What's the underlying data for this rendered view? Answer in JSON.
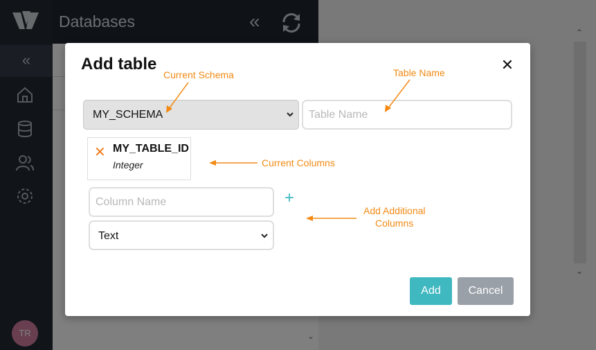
{
  "sidebar": {
    "collapse_glyph": "«",
    "user_initials": "TR",
    "icons": [
      "logo-icon",
      "home-icon",
      "database-icon",
      "users-icon",
      "gear-icon"
    ]
  },
  "databases_panel": {
    "title": "Databases",
    "collapse_glyph": "«",
    "scroll_down_glyph": "⌄"
  },
  "main": {
    "scroll_up_glyph": "⌃",
    "scroll_down_glyph": "⌄"
  },
  "modal": {
    "title": "Add table",
    "close_glyph": "✕",
    "schema_select": {
      "value": "MY_SCHEMA"
    },
    "table_name_input": {
      "placeholder": "Table Name",
      "value": ""
    },
    "columns": [
      {
        "name": "MY_TABLE_ID",
        "type": "Integer",
        "remove_glyph": "✕"
      }
    ],
    "new_column": {
      "name_placeholder": "Column Name",
      "type_value": "Text",
      "add_glyph": "+"
    },
    "buttons": {
      "add": "Add",
      "cancel": "Cancel"
    }
  },
  "annotations": {
    "current_schema": "Current Schema",
    "table_name": "Table Name",
    "current_columns": "Current Columns",
    "add_additional_columns_line1": "Add Additional",
    "add_additional_columns_line2": "Columns"
  },
  "colors": {
    "accent": "#3fb8c0",
    "annotation": "#f28a14",
    "remove": "#f07c1e",
    "cancel": "#9aa0a8",
    "sidebar": "#222a33"
  }
}
